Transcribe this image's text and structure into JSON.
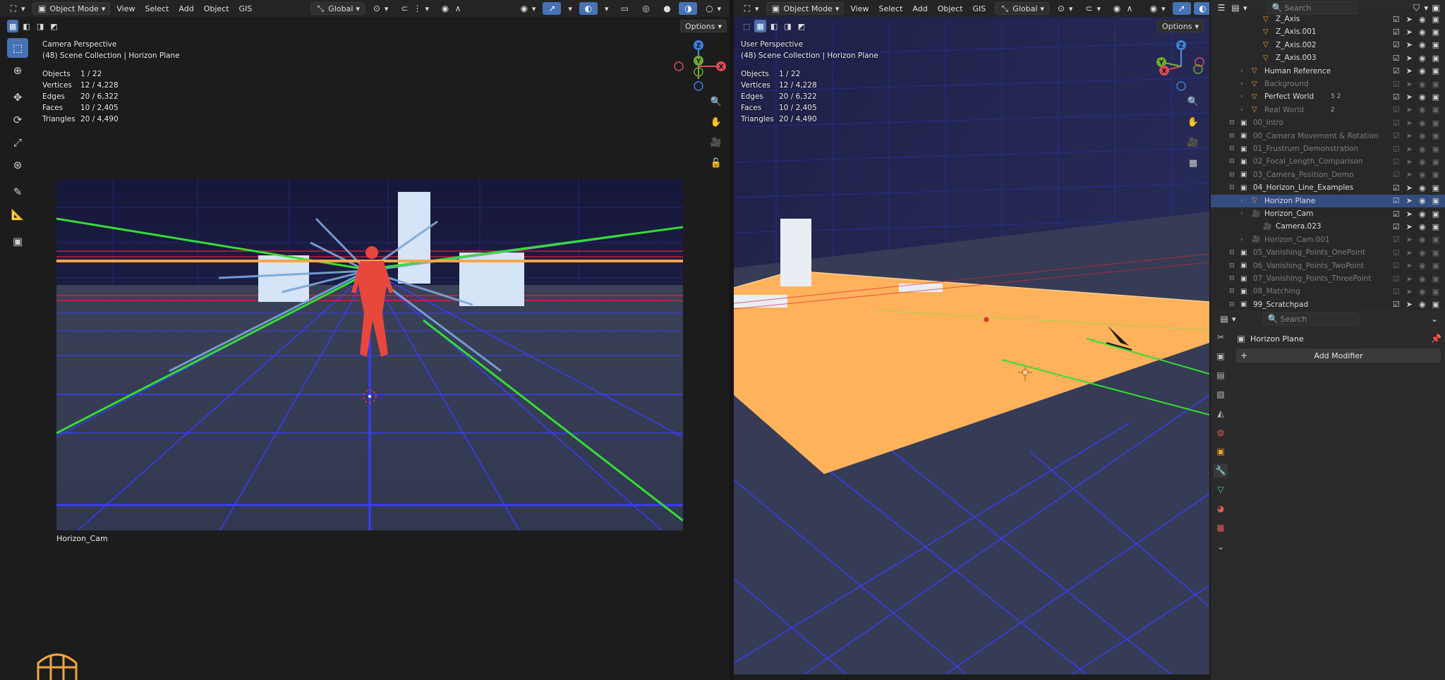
{
  "left_viewport": {
    "header": {
      "mode": "Object Mode",
      "menus": [
        "View",
        "Select",
        "Add",
        "Object",
        "GIS"
      ],
      "orientation": "Global",
      "options": "Options"
    },
    "overlay": {
      "title": "Camera Perspective",
      "subtitle": "(48) Scene Collection | Horizon Plane",
      "stats": [
        {
          "k": "Objects",
          "v": "1 / 22"
        },
        {
          "k": "Vertices",
          "v": "12 / 4,228"
        },
        {
          "k": "Edges",
          "v": "20 / 6,322"
        },
        {
          "k": "Faces",
          "v": "10 / 2,405"
        },
        {
          "k": "Triangles",
          "v": "20 / 4,490"
        }
      ]
    },
    "camera_name": "Horizon_Cam"
  },
  "right_viewport": {
    "header": {
      "mode": "Object Mode",
      "menus": [
        "View",
        "Select",
        "Add",
        "Object",
        "GIS"
      ],
      "orientation": "Global",
      "options": "Options"
    },
    "overlay": {
      "title": "User Perspective",
      "subtitle": "(48) Scene Collection | Horizon Plane",
      "stats": [
        {
          "k": "Objects",
          "v": "1 / 22"
        },
        {
          "k": "Vertices",
          "v": "12 / 4,228"
        },
        {
          "k": "Edges",
          "v": "20 / 6,322"
        },
        {
          "k": "Faces",
          "v": "10 / 2,405"
        },
        {
          "k": "Triangles",
          "v": "20 / 4,490"
        }
      ]
    }
  },
  "gizmo": {
    "z": "Z",
    "y": "Y",
    "x": "X"
  },
  "outliner": {
    "search_placeholder": "Search",
    "rows": [
      {
        "label": "Z_Axis",
        "indent": 3,
        "dim": false
      },
      {
        "label": "Z_Axis.001",
        "indent": 3,
        "dim": false
      },
      {
        "label": "Z_Axis.002",
        "indent": 3,
        "dim": false
      },
      {
        "label": "Z_Axis.003",
        "indent": 3,
        "dim": false
      },
      {
        "label": "Human Reference",
        "indent": 2,
        "dim": false
      },
      {
        "label": "Background",
        "indent": 2,
        "dim": true
      },
      {
        "label": "Perfect World",
        "indent": 2,
        "dim": false,
        "suffix": "5  2"
      },
      {
        "label": "Real World",
        "indent": 2,
        "dim": true,
        "suffix": "2"
      },
      {
        "label": "00_Intro",
        "indent": 1,
        "dim": true
      },
      {
        "label": "00_Camera Movement & Rotation",
        "indent": 1,
        "dim": true
      },
      {
        "label": "01_Frustrum_Demonstration",
        "indent": 1,
        "dim": true
      },
      {
        "label": "02_Focal_Length_Comparison",
        "indent": 1,
        "dim": true
      },
      {
        "label": "03_Camera_Position_Demo",
        "indent": 1,
        "dim": true
      },
      {
        "label": "04_Horizon_Line_Examples",
        "indent": 1,
        "dim": false
      },
      {
        "label": "Horizon Plane",
        "indent": 2,
        "dim": false,
        "highlight": true
      },
      {
        "label": "Horizon_Cam",
        "indent": 2,
        "dim": false
      },
      {
        "label": "Camera.023",
        "indent": 3,
        "dim": false
      },
      {
        "label": "Horizon_Cam.001",
        "indent": 2,
        "dim": true
      },
      {
        "label": "05_Vanishing_Points_OnePoint",
        "indent": 1,
        "dim": true
      },
      {
        "label": "06_Vanishing_Points_TwoPoint",
        "indent": 1,
        "dim": true
      },
      {
        "label": "07_Vanishing_Points_ThreePoint",
        "indent": 1,
        "dim": true
      },
      {
        "label": "08_Matching",
        "indent": 1,
        "dim": true
      },
      {
        "label": "99_Scratchpad",
        "indent": 1,
        "dim": false
      }
    ]
  },
  "properties": {
    "search_placeholder": "Search",
    "object_name": "Horizon Plane",
    "add_modifier": "Add Modifier"
  },
  "colors": {
    "accent": "#4772b3",
    "plane_orange": "#ffb25a",
    "grid_blue": "#3a3cff",
    "figure_red": "#e8473c",
    "horizon_orange": "#f7a54a",
    "green_line": "#33dd33"
  }
}
